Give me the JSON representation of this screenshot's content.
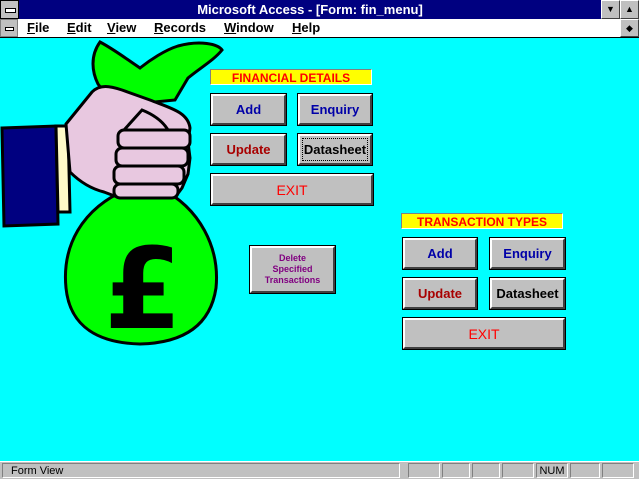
{
  "window": {
    "title": "Microsoft Access - [Form: fin_menu]"
  },
  "menu": [
    "File",
    "Edit",
    "View",
    "Records",
    "Window",
    "Help"
  ],
  "financial": {
    "label": "FINANCIAL DETAILS",
    "add": "Add",
    "enquiry": "Enquiry",
    "update": "Update",
    "datasheet": "Datasheet",
    "exit": "EXIT"
  },
  "transactions": {
    "label": "TRANSACTION TYPES",
    "add": "Add",
    "enquiry": "Enquiry",
    "update": "Update",
    "datasheet": "Datasheet",
    "exit": "EXIT"
  },
  "delete_button": "Delete\nSpecified\nTransactions",
  "illustration": {
    "symbol": "£"
  },
  "status": {
    "message": "Form View",
    "indicator": "NUM"
  },
  "colors": {
    "form_bg": "#00ffff",
    "bag": "#00ff00",
    "label_bg": "#ffff00",
    "titlebar": "#000080"
  }
}
